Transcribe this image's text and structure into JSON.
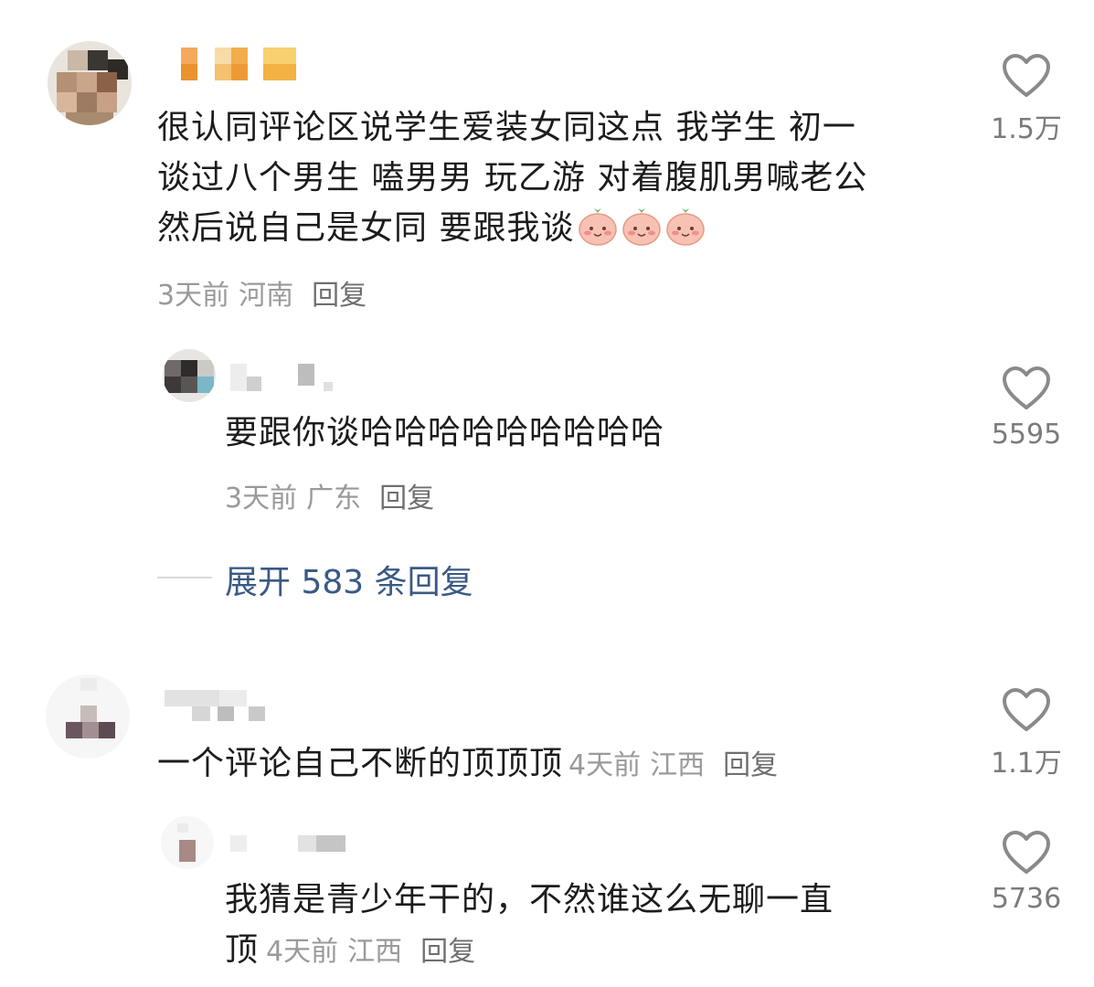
{
  "comments": [
    {
      "text_lines": [
        "很认同评论区说学生爱装女同这点 我学生 初一",
        "谈过八个男生 嗑男男 玩乙游 对着腹肌男喊老公",
        "然后说自己是女同 要跟我谈"
      ],
      "emojis": [
        "blush-peach-emoji",
        "blush-peach-emoji",
        "blush-peach-emoji"
      ],
      "time": "3天前",
      "location": "河南",
      "reply": "回复",
      "likes": "1.5万",
      "replies": [
        {
          "text": "要跟你谈哈哈哈哈哈哈哈哈哈",
          "time": "3天前",
          "location": "广东",
          "reply": "回复",
          "likes": "5595"
        }
      ],
      "expand_label": "展开 583 条回复"
    },
    {
      "text": "一个评论自己不断的顶顶顶",
      "time": "4天前",
      "location": "江西",
      "reply": "回复",
      "likes": "1.1万",
      "replies": [
        {
          "text_line1": "我猜是青少年干的，不然谁这么无聊一直",
          "text_line2": "顶",
          "time": "4天前",
          "location": "江西",
          "reply": "回复",
          "likes": "5736"
        }
      ]
    }
  ],
  "colors": {
    "text": "#1c1c1c",
    "meta": "#9a9a9a",
    "expand_link": "#3a5a85",
    "heart_outline": "#8a8a8a"
  },
  "icons": {
    "like": "heart-outline-icon"
  }
}
